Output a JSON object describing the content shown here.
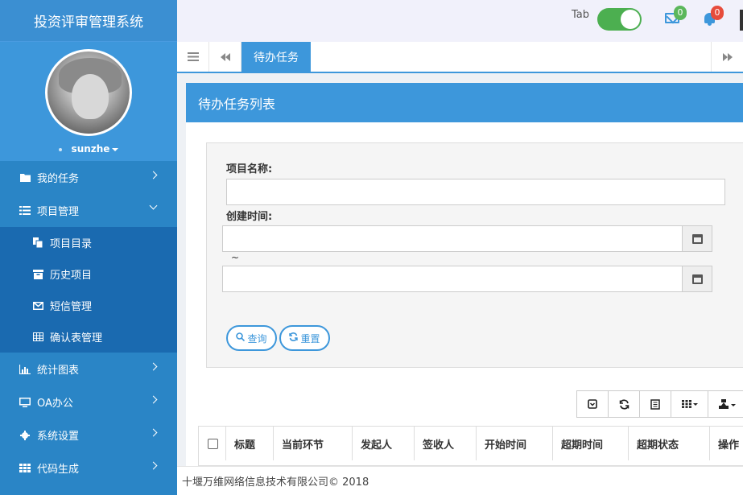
{
  "sidebar": {
    "title": "投资评审管理系统",
    "user": "sunzhe",
    "menu": [
      {
        "label": "我的任务",
        "icon": "folder-icon"
      },
      {
        "label": "项目管理",
        "icon": "list-icon"
      },
      {
        "label": "统计图表",
        "icon": "bar-chart-icon"
      },
      {
        "label": "OA办公",
        "icon": "monitor-icon"
      },
      {
        "label": "系统设置",
        "icon": "gear-icon"
      },
      {
        "label": "代码生成",
        "icon": "grid-icon"
      }
    ],
    "submenu": [
      {
        "label": "项目目录",
        "icon": "files-icon"
      },
      {
        "label": "历史项目",
        "icon": "archive-icon"
      },
      {
        "label": "短信管理",
        "icon": "envelope-icon"
      },
      {
        "label": "确认表管理",
        "icon": "table-icon"
      }
    ]
  },
  "topbar": {
    "tab_label": "Tab",
    "mail_count": "0",
    "bell_count": "0",
    "accent": "#3d97db",
    "toggle_color": "#4caf50"
  },
  "tabs": {
    "active": "待办任务"
  },
  "panel": {
    "title": "待办任务列表",
    "project_name_label": "项目名称:",
    "create_time_label": "创建时间:",
    "range_separator": "~",
    "query_button": "查询",
    "reset_button": "重置"
  },
  "table": {
    "columns": [
      "标题",
      "当前环节",
      "发起人",
      "签收人",
      "开始时间",
      "超期时间",
      "超期状态",
      "操作"
    ]
  },
  "footer": {
    "text": "十堰万维网络信息技术有限公司© 2018"
  }
}
